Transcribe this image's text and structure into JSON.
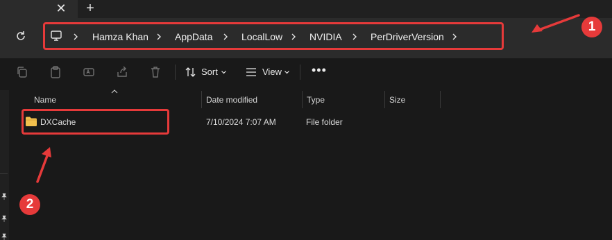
{
  "window": {
    "close_tab_glyph": "✕",
    "new_tab_glyph": "+"
  },
  "address": {
    "breadcrumbs": [
      "Hamza Khan",
      "AppData",
      "LocalLow",
      "NVIDIA",
      "PerDriverVersion"
    ]
  },
  "toolbar": {
    "sort_label": "Sort",
    "view_label": "View",
    "more_glyph": "•••"
  },
  "columns": {
    "name": "Name",
    "date_modified": "Date modified",
    "type": "Type",
    "size": "Size"
  },
  "files": [
    {
      "name": "DXCache",
      "date_modified": "7/10/2024 7:07 AM",
      "type": "File folder",
      "size": ""
    }
  ],
  "annotations": {
    "badge_1": "1",
    "badge_2": "2",
    "color": "#e63a3a"
  },
  "colors": {
    "folder": "#f2c04d",
    "background": "#191919",
    "address_bg": "#2b2b2b"
  }
}
